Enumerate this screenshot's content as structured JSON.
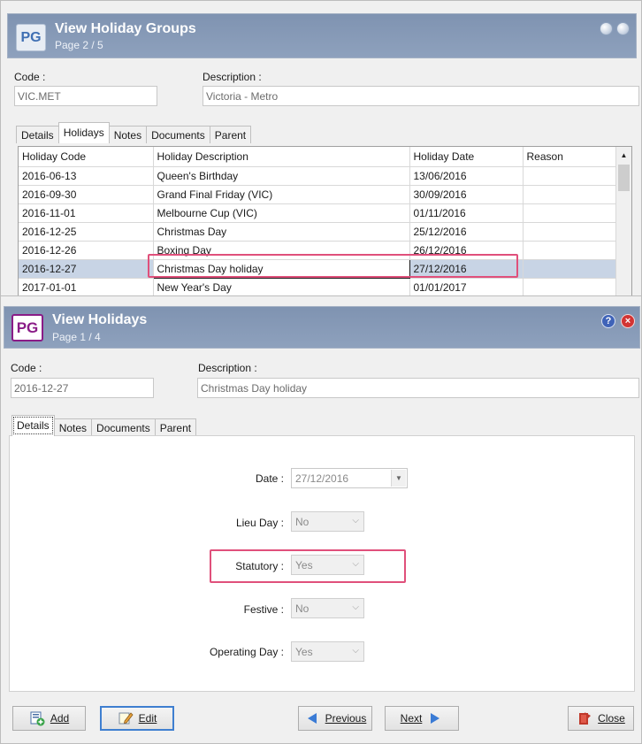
{
  "groups_window": {
    "title": "View Holiday Groups",
    "page": "Page 2 / 5",
    "logo": "PG",
    "code_label": "Code :",
    "code_value": "VIC.MET",
    "description_label": "Description :",
    "description_value": "Victoria - Metro",
    "tabs": [
      "Details",
      "Holidays",
      "Notes",
      "Documents",
      "Parent"
    ],
    "active_tab": "Holidays",
    "columns": [
      "Holiday Code",
      "Holiday Description",
      "Holiday Date",
      "Reason"
    ],
    "rows": [
      {
        "code": "2016-06-13",
        "description": "Queen's Birthday",
        "date": "13/06/2016",
        "reason": ""
      },
      {
        "code": "2016-09-30",
        "description": "Grand Final Friday (VIC)",
        "date": "30/09/2016",
        "reason": ""
      },
      {
        "code": "2016-11-01",
        "description": "Melbourne Cup (VIC)",
        "date": "01/11/2016",
        "reason": ""
      },
      {
        "code": "2016-12-25",
        "description": "Christmas Day",
        "date": "25/12/2016",
        "reason": ""
      },
      {
        "code": "2016-12-26",
        "description": "Boxing Day",
        "date": "26/12/2016",
        "reason": ""
      },
      {
        "code": "2016-12-27",
        "description": "Christmas Day holiday",
        "date": "27/12/2016",
        "reason": ""
      },
      {
        "code": "2017-01-01",
        "description": "New Year's Day",
        "date": "01/01/2017",
        "reason": ""
      }
    ],
    "selected_row": "2016-12-27"
  },
  "holiday_window": {
    "title": "View Holidays",
    "page": "Page 1 / 4",
    "logo": "PG",
    "help_glyph": "?",
    "close_glyph": "×",
    "code_label": "Code :",
    "code_value": "2016-12-27",
    "description_label": "Description :",
    "description_value": "Christmas Day holiday",
    "tabs": [
      "Details",
      "Notes",
      "Documents",
      "Parent"
    ],
    "active_tab": "Details",
    "fields": {
      "date": {
        "label": "Date :",
        "value": "27/12/2016"
      },
      "lieu_day": {
        "label": "Lieu Day :",
        "value": "No"
      },
      "statutory": {
        "label": "Statutory :",
        "value": "Yes"
      },
      "festive": {
        "label": "Festive :",
        "value": "No"
      },
      "operating_day": {
        "label": "Operating Day :",
        "value": "Yes"
      }
    },
    "buttons": {
      "add": "Add",
      "edit": "Edit",
      "previous": "Previous",
      "next": "Next",
      "close": "Close"
    }
  },
  "colors": {
    "titlebar": "#8597b4",
    "selected_row": "#c8d4e5",
    "highlight": "#e0507b",
    "logo_purple": "#8a1c87"
  },
  "icons": [
    "help-icon",
    "close-icon",
    "add-icon",
    "edit-icon",
    "previous-arrow-icon",
    "next-arrow-icon",
    "close-door-icon"
  ]
}
